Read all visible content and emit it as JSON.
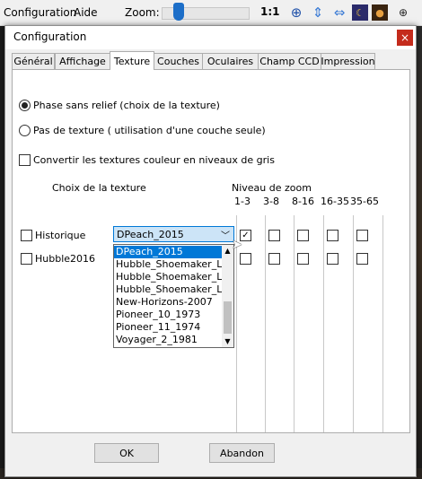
{
  "menubar": {
    "configuration": "Configuration",
    "aide": "Aide",
    "zoom_label": "Zoom:",
    "zoom_ratio": "1:1",
    "icons": [
      "crosshair-icon",
      "vertical-flip-icon",
      "horizontal-flip-icon",
      "moon-image-icon",
      "planet-image-icon",
      "user-image-icon",
      "globe-icon"
    ]
  },
  "dialog": {
    "title": "Configuration",
    "close": "×",
    "tabs": [
      "Général",
      "Affichage",
      "Texture",
      "Couches",
      "Oculaires",
      "Champ CCD",
      "Impression"
    ],
    "active_tab": "Texture"
  },
  "texture": {
    "radio_relief": "Phase sans relief (choix de la texture)",
    "radio_none": "Pas de texture ( utilisation d'une couche seule)",
    "checkbox_gray": "Convertir les textures couleur en niveaux de gris",
    "choice_header": "Choix de la texture",
    "zoom_header": "Niveau de zoom",
    "zoom_levels": [
      "1-3",
      "3-8",
      "8-16",
      "16-35",
      "35-65"
    ],
    "rows": [
      {
        "label": "Historique",
        "checked": false
      },
      {
        "label": "Hubble2016",
        "checked": false
      }
    ],
    "dropdown_value": "DPeach_2015",
    "dropdown_options": [
      "DPeach_2015",
      "Hubble_Shoemaker_Lev",
      "Hubble_Shoemaker_Lev",
      "Hubble_Shoemaker_Lev",
      "New-Horizons-2007",
      "Pioneer_10_1973",
      "Pioneer_11_1974",
      "Voyager_2_1981"
    ]
  },
  "buttons": {
    "ok": "OK",
    "cancel": "Abandon"
  },
  "colors": {
    "accent": "#0078d7",
    "selection_bg": "#cce4f7",
    "close": "#c42b1c"
  }
}
